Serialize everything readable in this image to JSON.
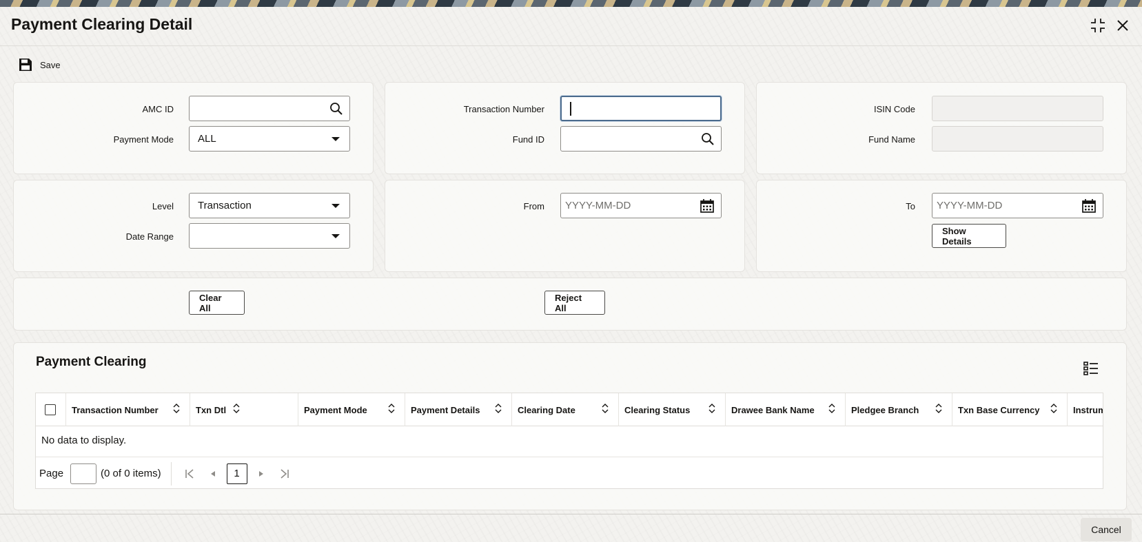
{
  "window": {
    "title": "Payment Clearing Detail",
    "icons": [
      "expand-icon",
      "close-icon"
    ]
  },
  "toolbar": {
    "save_label": "Save"
  },
  "form": {
    "amc_id": {
      "label": "AMC ID",
      "value": ""
    },
    "payment_mode": {
      "label": "Payment Mode",
      "value": "ALL"
    },
    "transaction_number": {
      "label": "Transaction Number",
      "value": ""
    },
    "fund_id": {
      "label": "Fund ID",
      "value": ""
    },
    "isin_code": {
      "label": "ISIN Code",
      "value": ""
    },
    "fund_name": {
      "label": "Fund Name",
      "value": ""
    },
    "level": {
      "label": "Level",
      "value": "Transaction"
    },
    "date_range": {
      "label": "Date Range",
      "value": ""
    },
    "from": {
      "label": "From",
      "placeholder": "YYYY-MM-DD"
    },
    "to": {
      "label": "To",
      "placeholder": "YYYY-MM-DD"
    },
    "show_details_label": "Show Details",
    "clear_all_label": "Clear All",
    "reject_all_label": "Reject All"
  },
  "grid": {
    "title": "Payment Clearing",
    "columns": [
      "Transaction Number",
      "Txn Dtl",
      "Payment Mode",
      "Payment Details",
      "Clearing Date",
      "Clearing Status",
      "Drawee Bank Name",
      "Pledgee Branch",
      "Txn Base Currency",
      "Instrum"
    ],
    "empty_text": "No data to display.",
    "pager": {
      "page_label": "Page",
      "count_text": "(0 of 0 items)",
      "current_page": "1"
    }
  },
  "footer": {
    "cancel_label": "Cancel"
  }
}
